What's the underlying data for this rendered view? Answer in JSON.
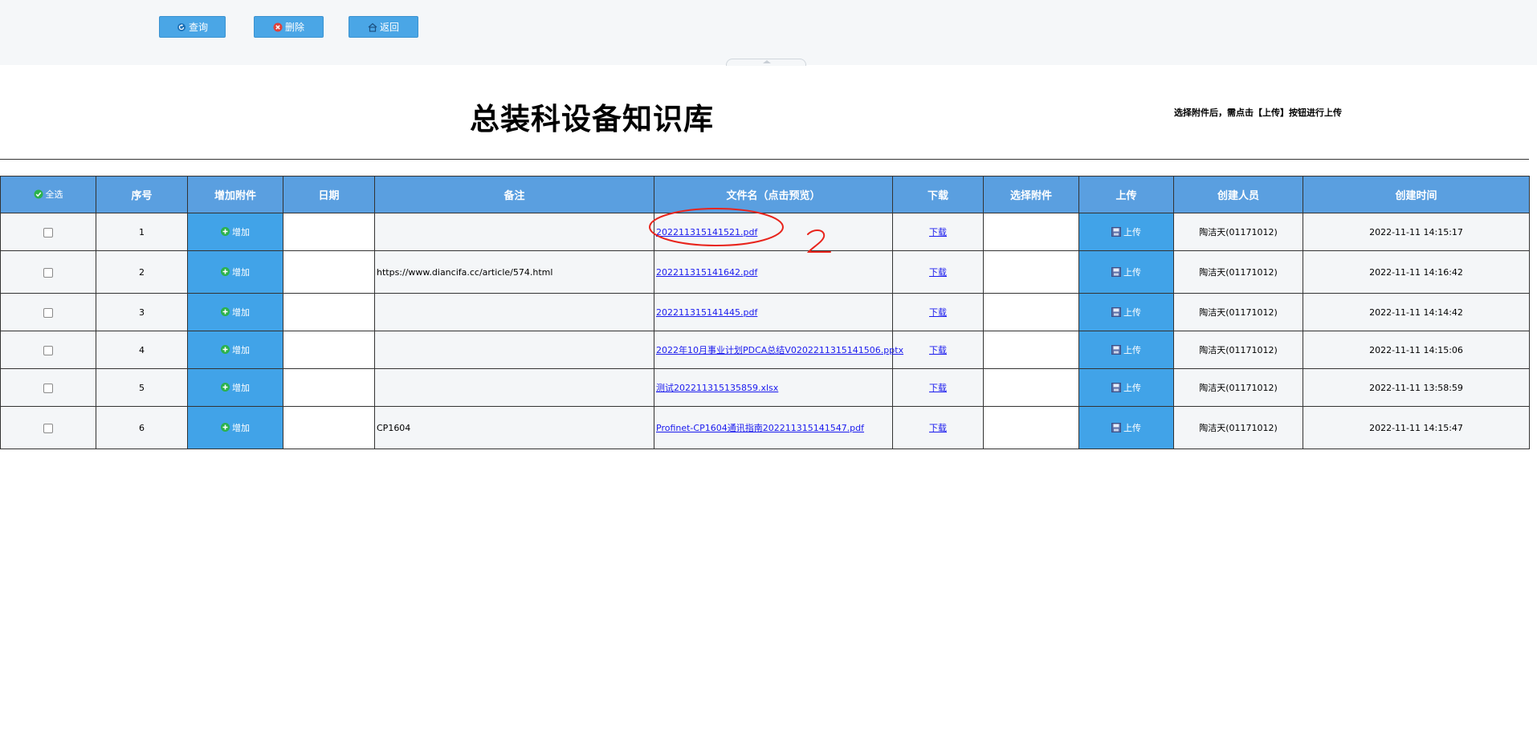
{
  "toolbar": {
    "query_label": "查询",
    "delete_label": "删除",
    "back_label": "返回"
  },
  "page": {
    "title": "总装科设备知识库",
    "hint": "选择附件后，需点击【上传】按钮进行上传"
  },
  "table": {
    "headers": {
      "select_all": "全选",
      "index": "序号",
      "add_attachment": "增加附件",
      "date": "日期",
      "note": "备注",
      "filename": "文件名（点击预览）",
      "download": "下载",
      "choose_attachment": "选择附件",
      "upload": "上传",
      "creator": "创建人员",
      "created_at": "创建时间"
    },
    "add_label": "增加",
    "upload_label": "上传",
    "download_label": "下载",
    "rows": [
      {
        "index": "1",
        "note": "",
        "filename": "202211315141521.pdf",
        "creator": "陶洁天(01171012)",
        "created_at": "2022-11-11 14:15:17"
      },
      {
        "index": "2",
        "note": "https://www.diancifa.cc/article/574.html",
        "filename": "202211315141642.pdf",
        "creator": "陶洁天(01171012)",
        "created_at": "2022-11-11 14:16:42"
      },
      {
        "index": "3",
        "note": "",
        "filename": "202211315141445.pdf",
        "creator": "陶洁天(01171012)",
        "created_at": "2022-11-11 14:14:42"
      },
      {
        "index": "4",
        "note": "",
        "filename": "2022年10月事业计划PDCA总结V0202211315141506.pptx",
        "creator": "陶洁天(01171012)",
        "created_at": "2022-11-11 14:15:06"
      },
      {
        "index": "5",
        "note": "",
        "filename": "测试202211315135859.xlsx",
        "creator": "陶洁天(01171012)",
        "created_at": "2022-11-11 13:58:59"
      },
      {
        "index": "6",
        "note": "CP1604",
        "filename": "Profinet-CP1604通讯指南202211315141547.pdf",
        "creator": "陶洁天(01171012)",
        "created_at": "2022-11-11 14:15:47"
      }
    ]
  },
  "icons": {
    "query": "refresh-icon",
    "delete": "close-circle-icon",
    "back": "home-icon",
    "add": "plus-icon",
    "upload": "save-icon",
    "select_all": "check-circle-icon"
  },
  "colors": {
    "header_bg": "#5a9fe0",
    "button_bg": "#4aa6e6",
    "link": "#1a1aee",
    "annotation": "#e8241c"
  }
}
